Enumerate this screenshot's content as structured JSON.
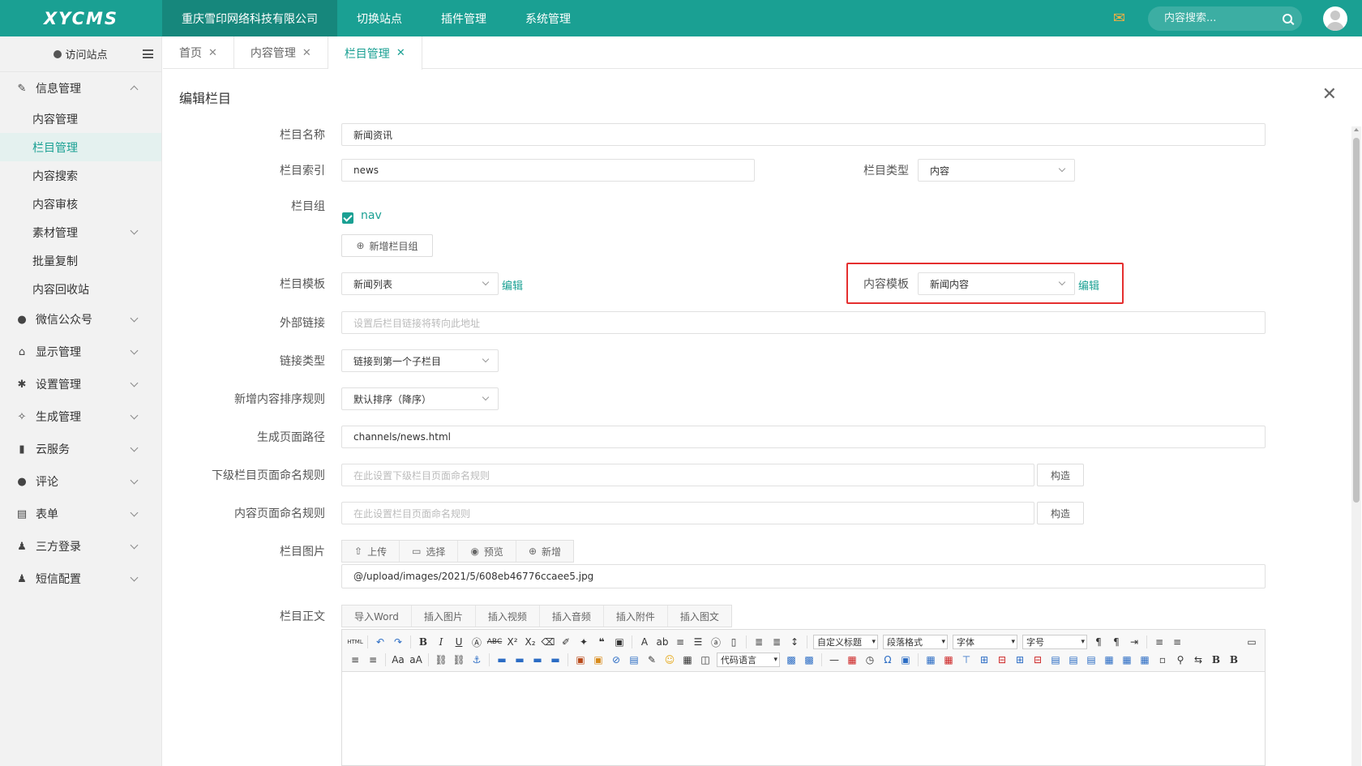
{
  "brand": {
    "logo": "XYCMS",
    "accent": "#1aa093"
  },
  "topnav": [
    {
      "label": "重庆雪印网络科技有限公司"
    },
    {
      "label": "切换站点"
    },
    {
      "label": "插件管理"
    },
    {
      "label": "系统管理"
    }
  ],
  "search": {
    "placeholder": "内容搜索..."
  },
  "sidebar": {
    "visit": "访问站点",
    "groups": [
      {
        "label": "信息管理"
      },
      {
        "label": "微信公众号"
      },
      {
        "label": "显示管理"
      },
      {
        "label": "设置管理"
      },
      {
        "label": "生成管理"
      },
      {
        "label": "云服务"
      },
      {
        "label": "评论"
      },
      {
        "label": "表单"
      },
      {
        "label": "三方登录"
      },
      {
        "label": "短信配置"
      }
    ],
    "sub_items": [
      {
        "label": "内容管理"
      },
      {
        "label": "栏目管理"
      },
      {
        "label": "内容搜索"
      },
      {
        "label": "内容审核"
      },
      {
        "label": "素材管理"
      },
      {
        "label": "批量复制"
      },
      {
        "label": "内容回收站"
      }
    ]
  },
  "tabs": [
    {
      "label": "首页"
    },
    {
      "label": "内容管理"
    },
    {
      "label": "栏目管理"
    }
  ],
  "form": {
    "title": "编辑栏目",
    "channel_name": {
      "label": "栏目名称",
      "value": "新闻资讯"
    },
    "channel_index": {
      "label": "栏目索引",
      "value": "news"
    },
    "channel_type": {
      "label": "栏目类型",
      "value": "内容"
    },
    "channel_group": {
      "label": "栏目组",
      "checked_option": "nav",
      "add_button": "新增栏目组"
    },
    "channel_template": {
      "label": "栏目模板",
      "value": "新闻列表",
      "edit": "编辑"
    },
    "content_template": {
      "label": "内容模板",
      "value": "新闻内容",
      "edit": "编辑"
    },
    "external_link": {
      "label": "外部链接",
      "placeholder": "设置后栏目链接将转向此地址"
    },
    "link_type": {
      "label": "链接类型",
      "value": "链接到第一个子栏目"
    },
    "sort_rule": {
      "label": "新增内容排序规则",
      "value": "默认排序（降序）"
    },
    "page_path": {
      "label": "生成页面路径",
      "value": "channels/news.html"
    },
    "sub_naming": {
      "label": "下级栏目页面命名规则",
      "placeholder": "在此设置下级栏目页面命名规则",
      "button": "构造"
    },
    "content_naming": {
      "label": "内容页面命名规则",
      "placeholder": "在此设置栏目页面命名规则",
      "button": "构造"
    },
    "image": {
      "label": "栏目图片",
      "buttons": [
        "上传",
        "选择",
        "预览",
        "新增"
      ],
      "value": "@/upload/images/2021/5/608eb46776ccaee5.jpg"
    },
    "body": {
      "label": "栏目正文",
      "buttons": [
        "导入Word",
        "插入图片",
        "插入视频",
        "插入音频",
        "插入附件",
        "插入图文"
      ]
    }
  },
  "editor": {
    "selects": [
      "自定义标题",
      "段落格式",
      "字体",
      "字号",
      "代码语言"
    ]
  }
}
